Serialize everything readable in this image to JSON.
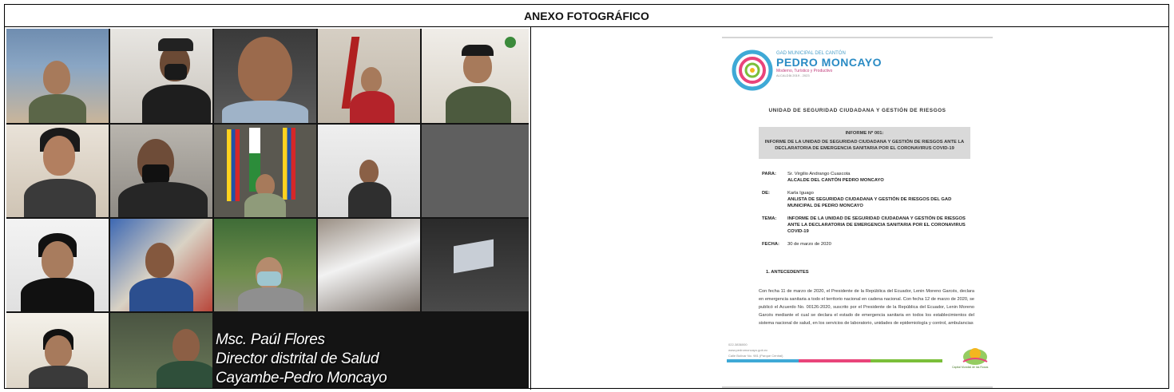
{
  "header": {
    "title": "ANEXO FOTOGRÁFICO"
  },
  "video_call": {
    "caption_lines": [
      "Msc. Paúl Flores",
      "Director distrital de Salud",
      "Cayambe-Pedro Moncayo"
    ]
  },
  "document": {
    "org": {
      "line1": "GAD MUNICIPAL DEL CANTÓN",
      "name": "PEDRO MONCAYO",
      "tagline": "Moderno, Turístico y Productivo",
      "period": "ALCALDÍA 2019 - 2023"
    },
    "unit_title": "UNIDAD DE SEGURIDAD CIUDADANA Y GESTIÓN DE RIESGOS",
    "report_no": "INFORME Nº 001:",
    "report_title": "INFORME DE LA UNIDAD DE SEGURIDAD CIUDADANA Y GESTIÓN DE RIESGOS ANTE LA DECLARATORIA DE EMERGENCIA SANITARIA POR EL CORONAVIRUS COVID-19",
    "para_label": "PARA:",
    "para_name": "Sr. Virgilio Andrango Cuascota",
    "para_role": "ALCALDE DEL CANTÓN PEDRO MONCAYO",
    "de_label": "DE:",
    "de_name": "Karla Iguago",
    "de_role": "ANLISTA DE SEGURIDAD CIUDADANA Y GESTIÓN DE RIESGOS DEL GAD MUNICIPAL DE PEDRO MONCAYO",
    "tema_label": "TEMA:",
    "tema_value": "INFORME DE LA UNIDAD DE SEGURIDAD CIUDADANA Y GESTIÓN DE RIESGOS ANTE LA DECLARATORIA DE EMERGENCIA SANITARIA POR EL CORONAVIRUS COVID-19",
    "fecha_label": "FECHA:",
    "fecha_value": "30 de marzo de 2020",
    "section": "1.   ANTECEDENTES",
    "paragraph": "Con fecha 11 de marzo de 2020, el Presidente de la República del Ecuador, Lenin Moreno Garcés, declara en emergencia sanitaria a todo el territorio nacional en cadena nacional. Con fecha 12 de marzo de 2020, se publicó el Acuerdo No. 00126-2020, suscrito por el Presidente de la República del Ecuador, Lenin Moreno Garcés mediante el cual se declara el estado de emergencia sanitaria en todos los establecimientos del sistema nacional de salud, en los servicios de laboratorio, unidades de epidemiología y control, ambulancias",
    "footer_lines": [
      "022-3836000",
      "www.pedromoncayo.gob.ec",
      "Calle Bolívar No. 981 (Parque Central)"
    ],
    "crest_text": "Capital Mundial de las Rosas"
  }
}
